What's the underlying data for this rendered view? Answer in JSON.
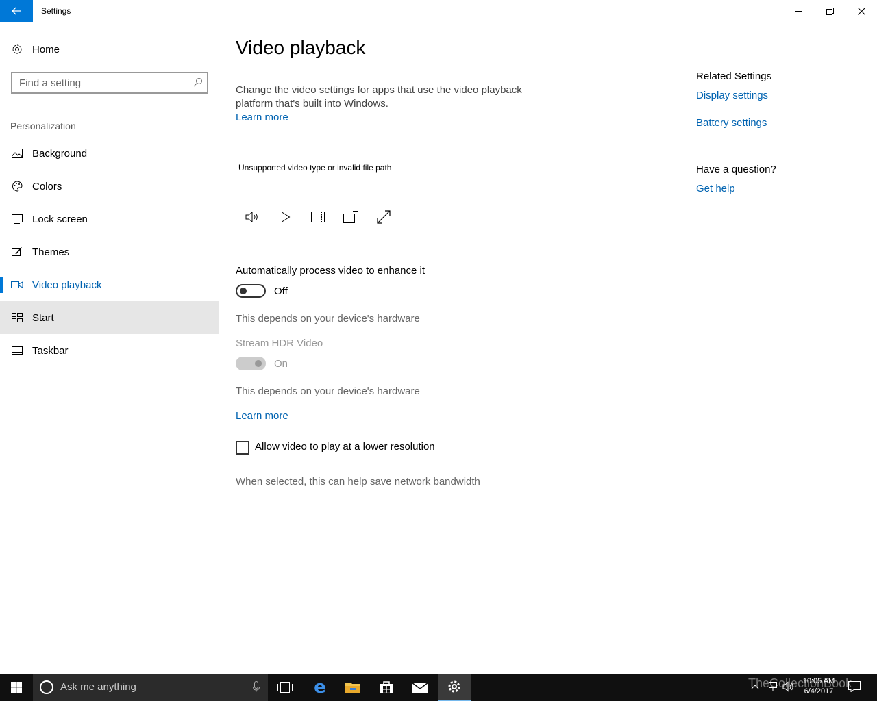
{
  "window": {
    "title": "Settings"
  },
  "sidebar": {
    "home_label": "Home",
    "search_placeholder": "Find a setting",
    "section_label": "Personalization",
    "items": [
      {
        "label": "Background",
        "icon": "picture-icon"
      },
      {
        "label": "Colors",
        "icon": "palette-icon"
      },
      {
        "label": "Lock screen",
        "icon": "lock-screen-icon"
      },
      {
        "label": "Themes",
        "icon": "brush-icon"
      },
      {
        "label": "Video playback",
        "icon": "video-icon",
        "active": true
      },
      {
        "label": "Start",
        "icon": "start-icon",
        "hover": true
      },
      {
        "label": "Taskbar",
        "icon": "taskbar-icon"
      }
    ]
  },
  "main": {
    "title": "Video playback",
    "description": "Change the video settings for apps that use the video playback platform that's built into Windows.",
    "learn_more": "Learn more",
    "video_error": "Unsupported video type or invalid file path",
    "player_controls": [
      "volume-icon",
      "play-icon",
      "aspect-ratio-icon",
      "cast-icon",
      "fullscreen-icon"
    ],
    "auto_process": {
      "title": "Automatically process video to enhance it",
      "state": "Off",
      "hint": "This depends on your device's hardware"
    },
    "hdr": {
      "title": "Stream HDR Video",
      "state": "On",
      "hint": "This depends on your device's hardware",
      "learn_more": "Learn more"
    },
    "lower_res": {
      "label": "Allow video to play at a lower resolution",
      "checked": false,
      "hint": "When selected, this can help save network bandwidth"
    }
  },
  "related": {
    "heading": "Related Settings",
    "display_link": "Display settings",
    "battery_link": "Battery settings",
    "question_heading": "Have a question?",
    "help_link": "Get help"
  },
  "taskbar": {
    "search_text": "Ask me anything",
    "watermark": "TheCollectionBook",
    "time": "10:05 AM",
    "date": "6/4/2017"
  },
  "colors": {
    "accent": "#0078d7",
    "link": "#0063b1",
    "taskbar": "#101010"
  }
}
